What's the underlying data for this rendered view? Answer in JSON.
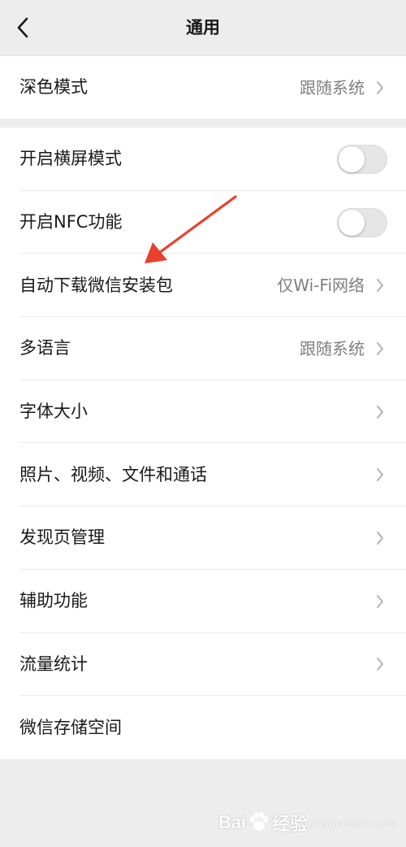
{
  "header": {
    "title": "通用",
    "back_icon": "chevron-left-icon"
  },
  "group1": {
    "items": [
      {
        "label": "深色模式",
        "value": "跟随系统"
      }
    ]
  },
  "group2": {
    "items": [
      {
        "label": "开启横屏模式",
        "toggle_on": false
      },
      {
        "label": "开启NFC功能",
        "toggle_on": false
      },
      {
        "label": "自动下载微信安装包",
        "value": "仅Wi-Fi网络"
      },
      {
        "label": "多语言",
        "value": "跟随系统"
      },
      {
        "label": "字体大小"
      },
      {
        "label": "照片、视频、文件和通话"
      },
      {
        "label": "发现页管理"
      },
      {
        "label": "辅助功能"
      },
      {
        "label": "流量统计"
      },
      {
        "label": "微信存储空间"
      }
    ]
  },
  "colors": {
    "background": "#ededed",
    "row_background": "#ffffff",
    "primary_text": "#191919",
    "secondary_text": "#7f7f7f",
    "annotation_arrow": "#e8412c"
  },
  "watermark": {
    "brand_left": "Bai",
    "brand_right": "经验",
    "sub": "jingyan.baidu.com"
  }
}
